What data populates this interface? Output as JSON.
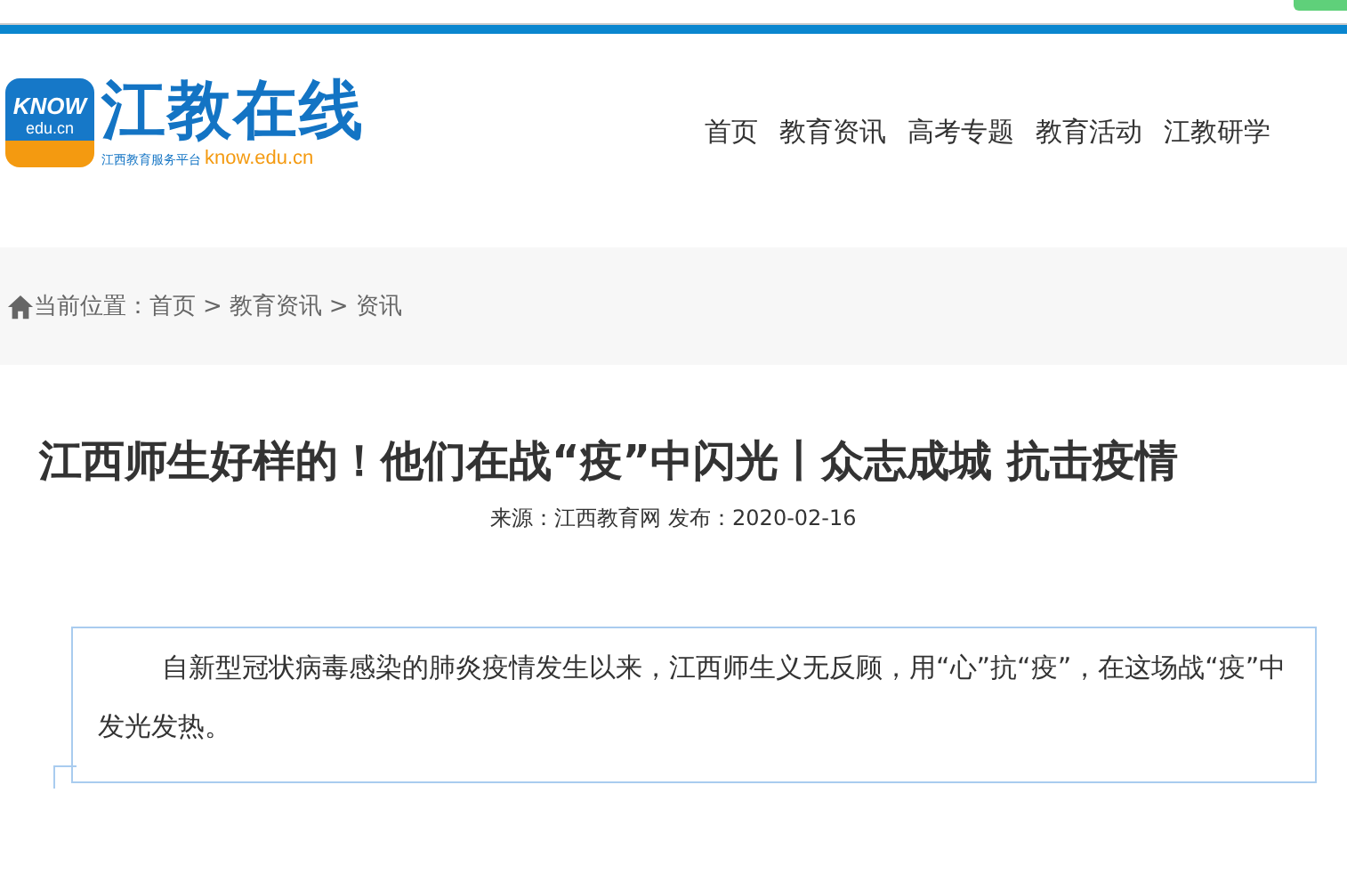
{
  "logo": {
    "badge_top": "KNOW",
    "badge_bottom": "edu.cn",
    "name": "江教在线",
    "tagline": "江西教育服务平台",
    "domain": "know.edu.cn"
  },
  "nav": [
    {
      "label": "首页"
    },
    {
      "label": "教育资讯"
    },
    {
      "label": "高考专题"
    },
    {
      "label": "教育活动"
    },
    {
      "label": "江教研学"
    }
  ],
  "breadcrumb": {
    "label": "当前位置：",
    "items": [
      "首页",
      "教育资讯",
      "资讯"
    ],
    "separator": ">"
  },
  "article": {
    "title": "江西师生好样的！他们在战“疫”中闪光丨众志成城 抗击疫情",
    "meta": "来源：江西教育网 发布：2020-02-16",
    "summary": "自新型冠状病毒感染的肺炎疫情发生以来，江西师生义无反顾，用“心”抗“疫”，在这场战“疫”中发光发热。"
  }
}
